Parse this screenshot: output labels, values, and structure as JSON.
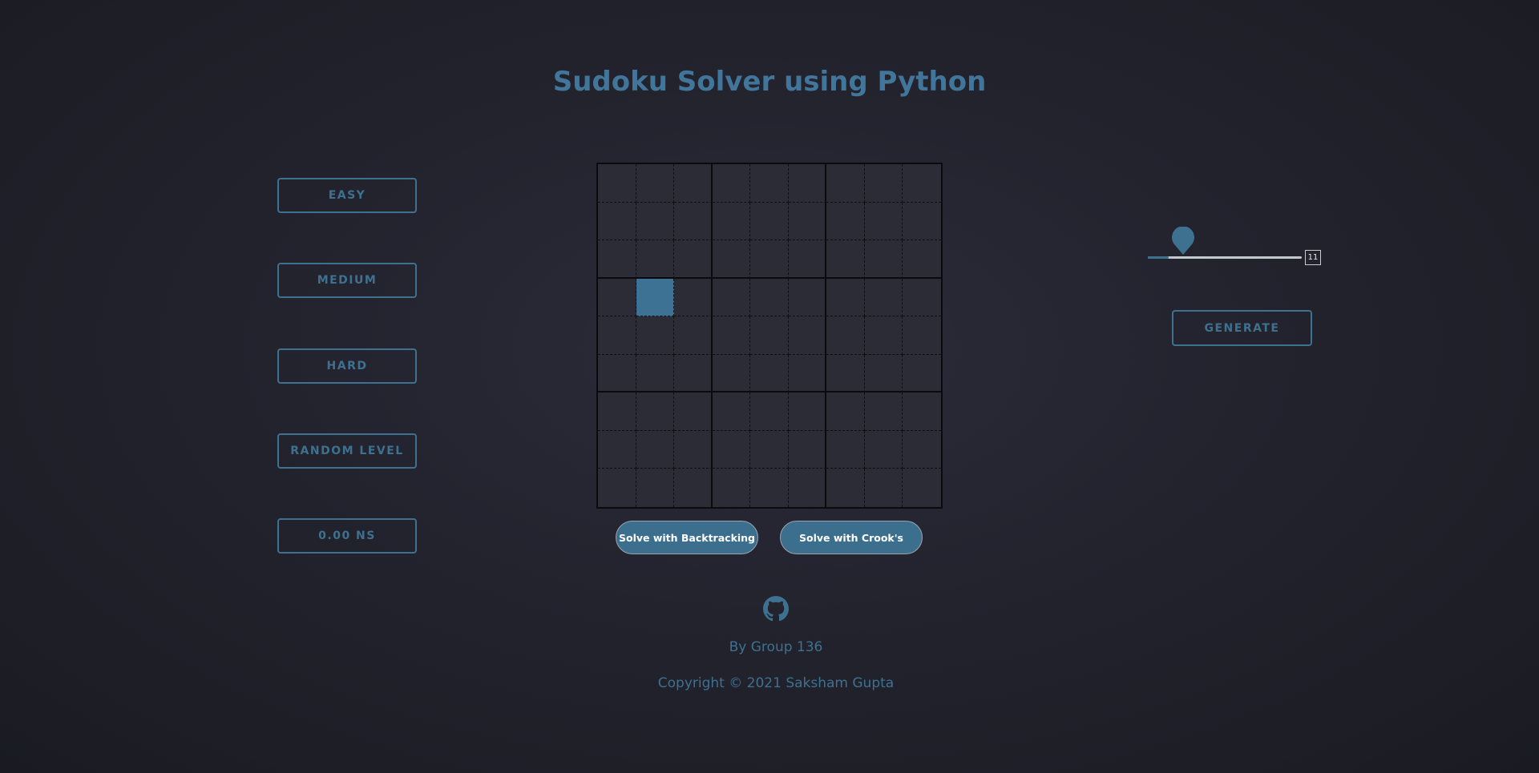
{
  "header": {
    "title": "Sudoku Solver using Python"
  },
  "levels": {
    "easy": "EASY",
    "medium": "MEDIUM",
    "hard": "HARD",
    "random": "RANDOM LEVEL",
    "timer": "0.00 NS"
  },
  "board": {
    "rows": 9,
    "cols": 9,
    "selected_cell": {
      "row": 4,
      "col": 2
    },
    "values": [
      [
        "",
        "",
        "",
        "",
        "",
        "",
        "",
        "",
        ""
      ],
      [
        "",
        "",
        "",
        "",
        "",
        "",
        "",
        "",
        ""
      ],
      [
        "",
        "",
        "",
        "",
        "",
        "",
        "",
        "",
        ""
      ],
      [
        "",
        "",
        "",
        "",
        "",
        "",
        "",
        "",
        ""
      ],
      [
        "",
        "",
        "",
        "",
        "",
        "",
        "",
        "",
        ""
      ],
      [
        "",
        "",
        "",
        "",
        "",
        "",
        "",
        "",
        ""
      ],
      [
        "",
        "",
        "",
        "",
        "",
        "",
        "",
        "",
        ""
      ],
      [
        "",
        "",
        "",
        "",
        "",
        "",
        "",
        "",
        ""
      ],
      [
        "",
        "",
        "",
        "",
        "",
        "",
        "",
        "",
        ""
      ]
    ]
  },
  "actions": {
    "solve_backtracking": "Solve with Backtracking",
    "solve_crook": "Solve with Crook's"
  },
  "generator": {
    "slider_value": "11",
    "slider_min": 0,
    "slider_max": 81,
    "generate_label": "GENERATE"
  },
  "footer": {
    "github_icon": "github-icon",
    "byline": "By Group 136",
    "copyright": "Copyright © 2021 Saksham Gupta"
  },
  "colors": {
    "accent": "#3e7190",
    "background": "#23232e",
    "cell": "#2c2c37",
    "selected": "#3d7294"
  }
}
